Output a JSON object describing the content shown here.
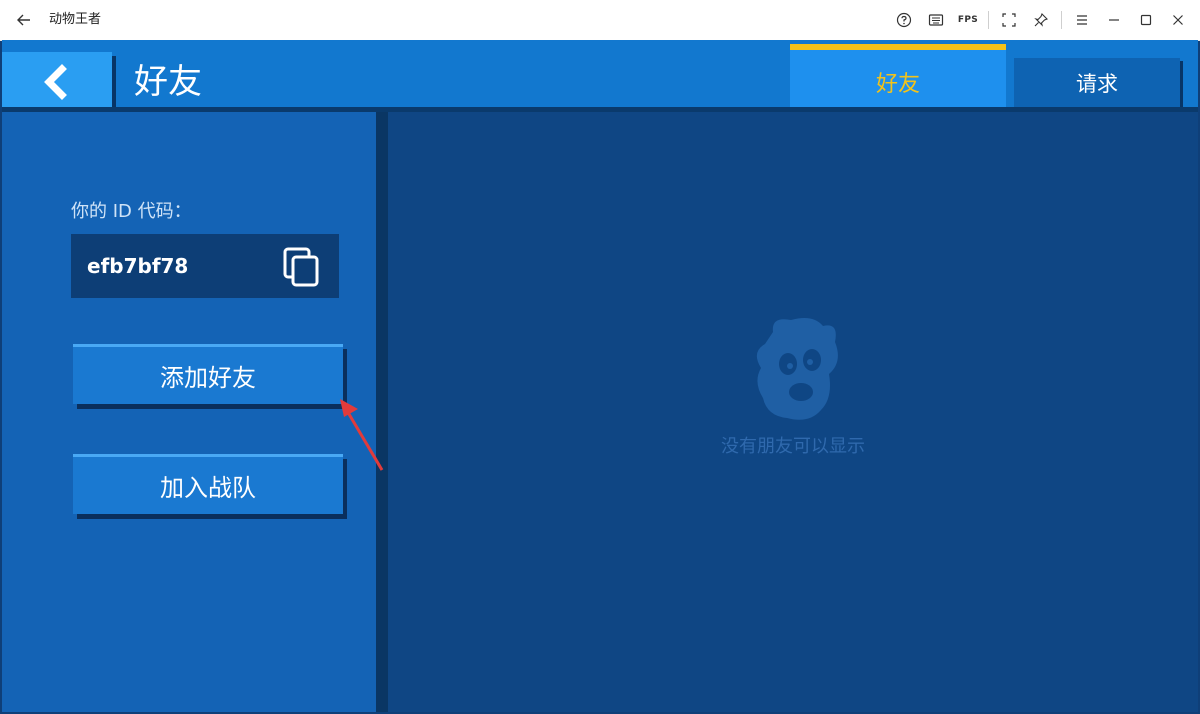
{
  "window": {
    "title": "动物王者",
    "fps_label": "FPS"
  },
  "header": {
    "title": "好友",
    "tabs": [
      {
        "label": "好友",
        "active": true
      },
      {
        "label": "请求",
        "active": false
      }
    ]
  },
  "left_panel": {
    "id_label": "你的 ID 代码：",
    "id_value": "efb7bf78",
    "buttons": [
      {
        "label": "添加好友"
      },
      {
        "label": "加入战队"
      }
    ]
  },
  "right_panel": {
    "empty_text": "没有朋友可以显示"
  },
  "colors": {
    "active_tab_text": "#f2c31b",
    "panel_blue": "#1463b5",
    "dark_blue": "#0f4684",
    "annotation_red": "#e23b3b"
  }
}
